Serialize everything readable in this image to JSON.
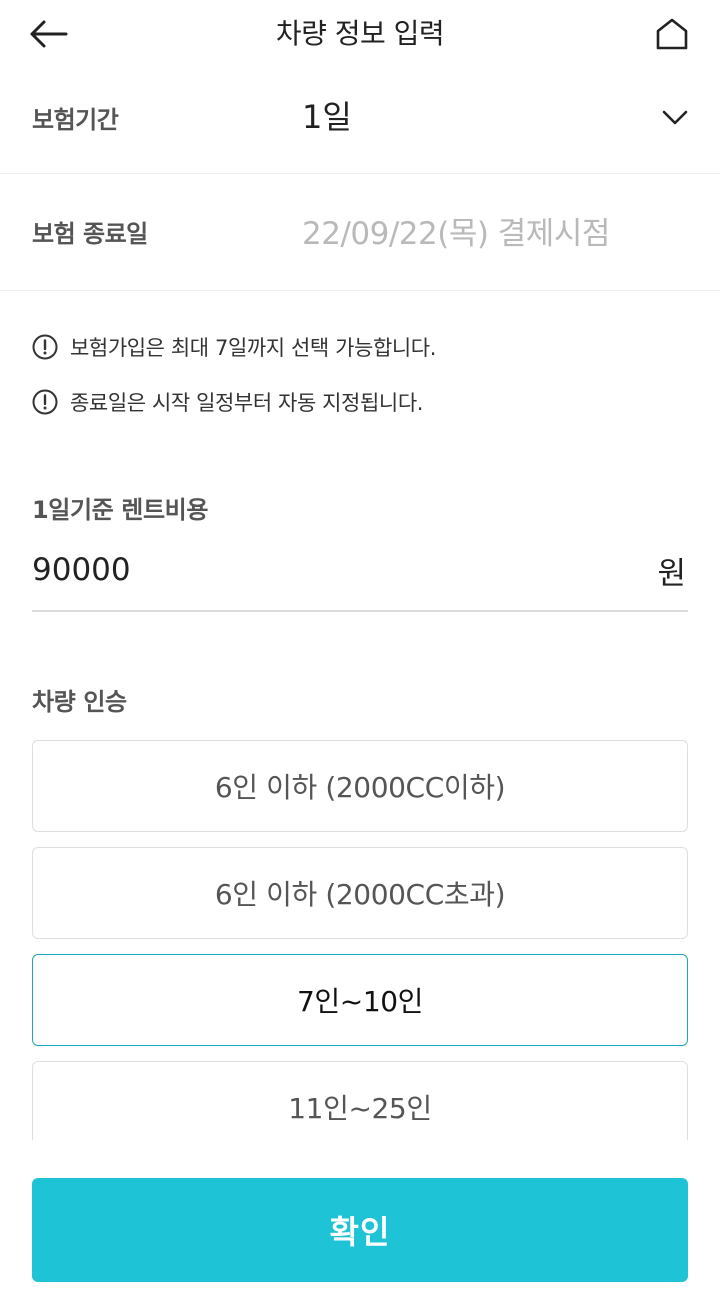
{
  "header": {
    "title": "차량 정보 입력",
    "back_icon": "arrow-left-icon",
    "home_icon": "home-icon"
  },
  "period": {
    "label": "보험기간",
    "value": "1일",
    "icon": "chevron-down-icon"
  },
  "end_date": {
    "label": "보험 종료일",
    "value": "22/09/22(목) 결제시점"
  },
  "notices": [
    {
      "icon": "info-circle-icon",
      "text": "보험가입은 최대 7일까지 선택 가능합니다."
    },
    {
      "icon": "info-circle-icon",
      "text": "종료일은 시작 일정부터 자동 지정됩니다."
    }
  ],
  "rent": {
    "label": "1일기준 렌트비용",
    "value": "90000",
    "unit": "원"
  },
  "capacity": {
    "label": "차량 인승",
    "options": [
      {
        "label": "6인 이하 (2000CC이하)",
        "selected": false
      },
      {
        "label": "6인 이하 (2000CC초과)",
        "selected": false
      },
      {
        "label": "7인~10인",
        "selected": true
      },
      {
        "label": "11인~25인",
        "selected": false
      }
    ]
  },
  "confirm": {
    "label": "확인"
  },
  "colors": {
    "accent": "#1ec4d6",
    "selected_border": "#1aa9b8",
    "placeholder_text": "#b9b9b9"
  }
}
